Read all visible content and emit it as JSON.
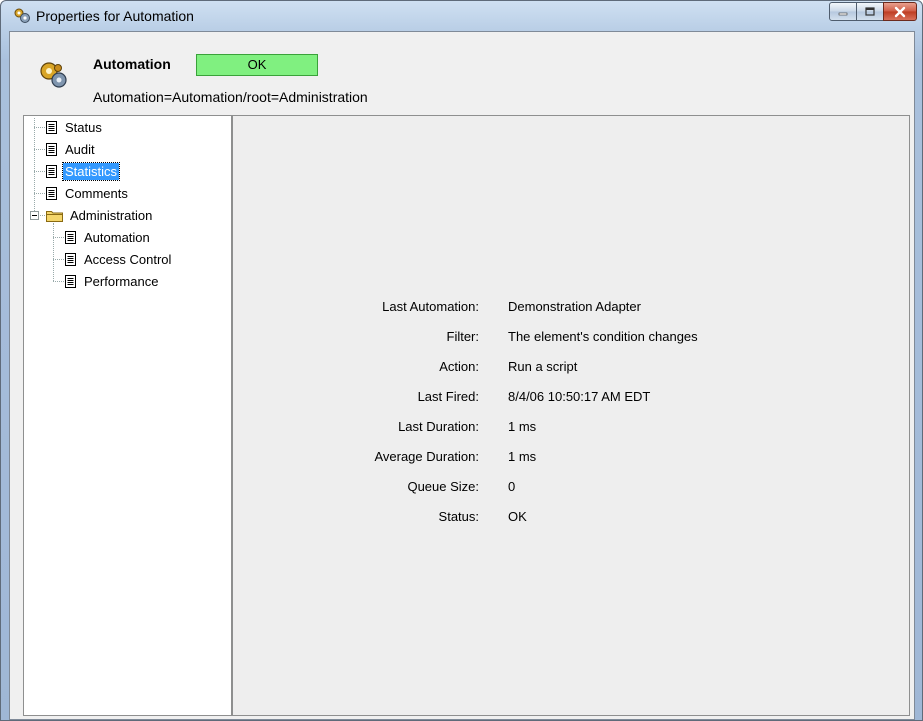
{
  "window": {
    "title": "Properties for Automation",
    "icon": "automation-gears-icon",
    "controls": [
      "minimize-icon",
      "maximize-icon",
      "close-icon"
    ]
  },
  "header": {
    "name": "Automation",
    "status": "OK",
    "status_color": "#80f080",
    "path": "Automation=Automation/root=Administration",
    "icon": "automation-gears-icon"
  },
  "tree": {
    "items": [
      {
        "label": "Status",
        "icon": "document-icon"
      },
      {
        "label": "Audit",
        "icon": "document-icon"
      },
      {
        "label": "Statistics",
        "icon": "document-icon",
        "selected": true
      },
      {
        "label": "Comments",
        "icon": "document-icon"
      },
      {
        "label": "Administration",
        "icon": "folder-icon",
        "expanded": true,
        "children": [
          {
            "label": "Automation",
            "icon": "document-icon"
          },
          {
            "label": "Access Control",
            "icon": "document-icon"
          },
          {
            "label": "Performance",
            "icon": "document-icon"
          }
        ]
      }
    ],
    "selection_color": "#3399ff"
  },
  "statistics": {
    "rows": [
      {
        "label": "Last Automation:",
        "value": "Demonstration Adapter"
      },
      {
        "label": "Filter:",
        "value": "The element's condition changes"
      },
      {
        "label": "Action:",
        "value": "Run a script"
      },
      {
        "label": "Last Fired:",
        "value": "8/4/06 10:50:17 AM EDT"
      },
      {
        "label": "Last Duration:",
        "value": "1 ms"
      },
      {
        "label": "Average Duration:",
        "value": "1 ms"
      },
      {
        "label": "Queue Size:",
        "value": "0"
      },
      {
        "label": "Status:",
        "value": "OK"
      }
    ]
  }
}
